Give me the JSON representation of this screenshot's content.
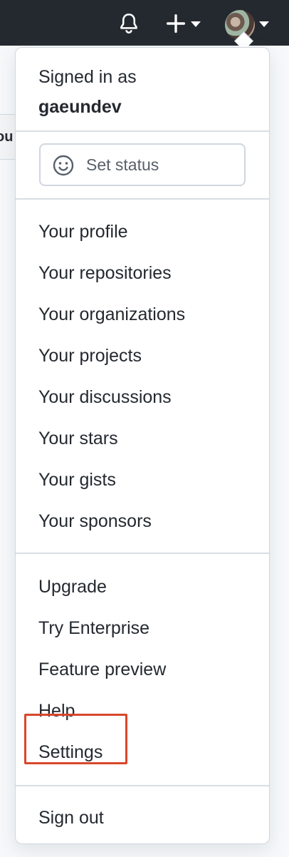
{
  "backdrop": {
    "partial_text": "ou"
  },
  "menu": {
    "signed_in_label": "Signed in as",
    "username": "gaeundev",
    "set_status": "Set status",
    "profile_items": [
      "Your profile",
      "Your repositories",
      "Your organizations",
      "Your projects",
      "Your discussions",
      "Your stars",
      "Your gists",
      "Your sponsors"
    ],
    "other_items": [
      "Upgrade",
      "Try Enterprise",
      "Feature preview",
      "Help",
      "Settings"
    ],
    "sign_out": "Sign out"
  },
  "icons": {
    "notifications": "bell-icon",
    "create": "plus-icon",
    "status": "smiley-icon"
  },
  "colors": {
    "header_bg": "#24292f",
    "highlight": "#d9472b"
  }
}
